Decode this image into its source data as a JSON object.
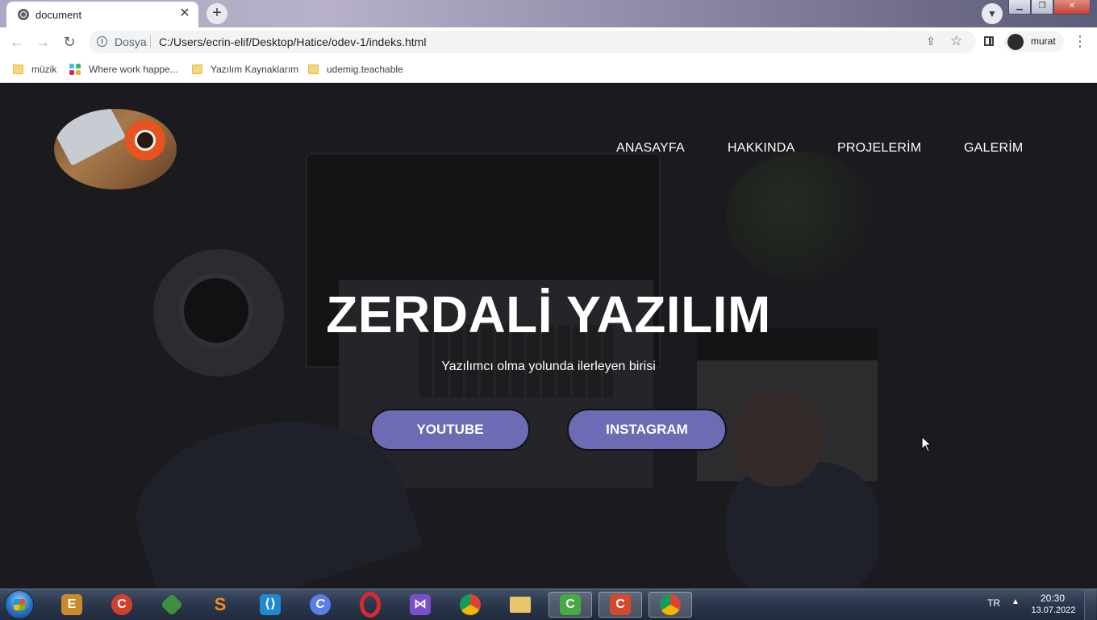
{
  "browser": {
    "tab_title": "document",
    "site_label": "Dosya",
    "url": "C:/Users/ecrin-elif/Desktop/Hatice/odev-1/indeks.html",
    "profile_name": "murat",
    "bookmarks": [
      {
        "label": "müzik",
        "icon": "folder-icon"
      },
      {
        "label": "Where work happe...",
        "icon": "slack-icon"
      },
      {
        "label": "Yazılım Kaynaklarım",
        "icon": "folder-icon"
      },
      {
        "label": "udemig.teachable",
        "icon": "folder-icon"
      }
    ]
  },
  "site": {
    "nav": [
      "ANASAYFA",
      "HAKKINDA",
      "PROJELERİM",
      "GALERİM"
    ],
    "hero_title": "ZERDALİ YAZILIM",
    "hero_subtitle": "Yazılımcı olma yolunda ilerleyen birisi",
    "buttons": [
      "YOUTUBE",
      "INSTAGRAM"
    ],
    "button_color": "#6d6bb4"
  },
  "taskbar": {
    "apps": [
      "start",
      "email-app",
      "ccleaner",
      "git",
      "sublime-text",
      "vscode",
      "cursor-editor",
      "opera",
      "visual-studio",
      "chrome",
      "file-explorer",
      "camtasia-recorder",
      "camtasia-studio",
      "chrome-active"
    ],
    "language": "TR",
    "time": "20:30",
    "date": "13.07.2022"
  }
}
